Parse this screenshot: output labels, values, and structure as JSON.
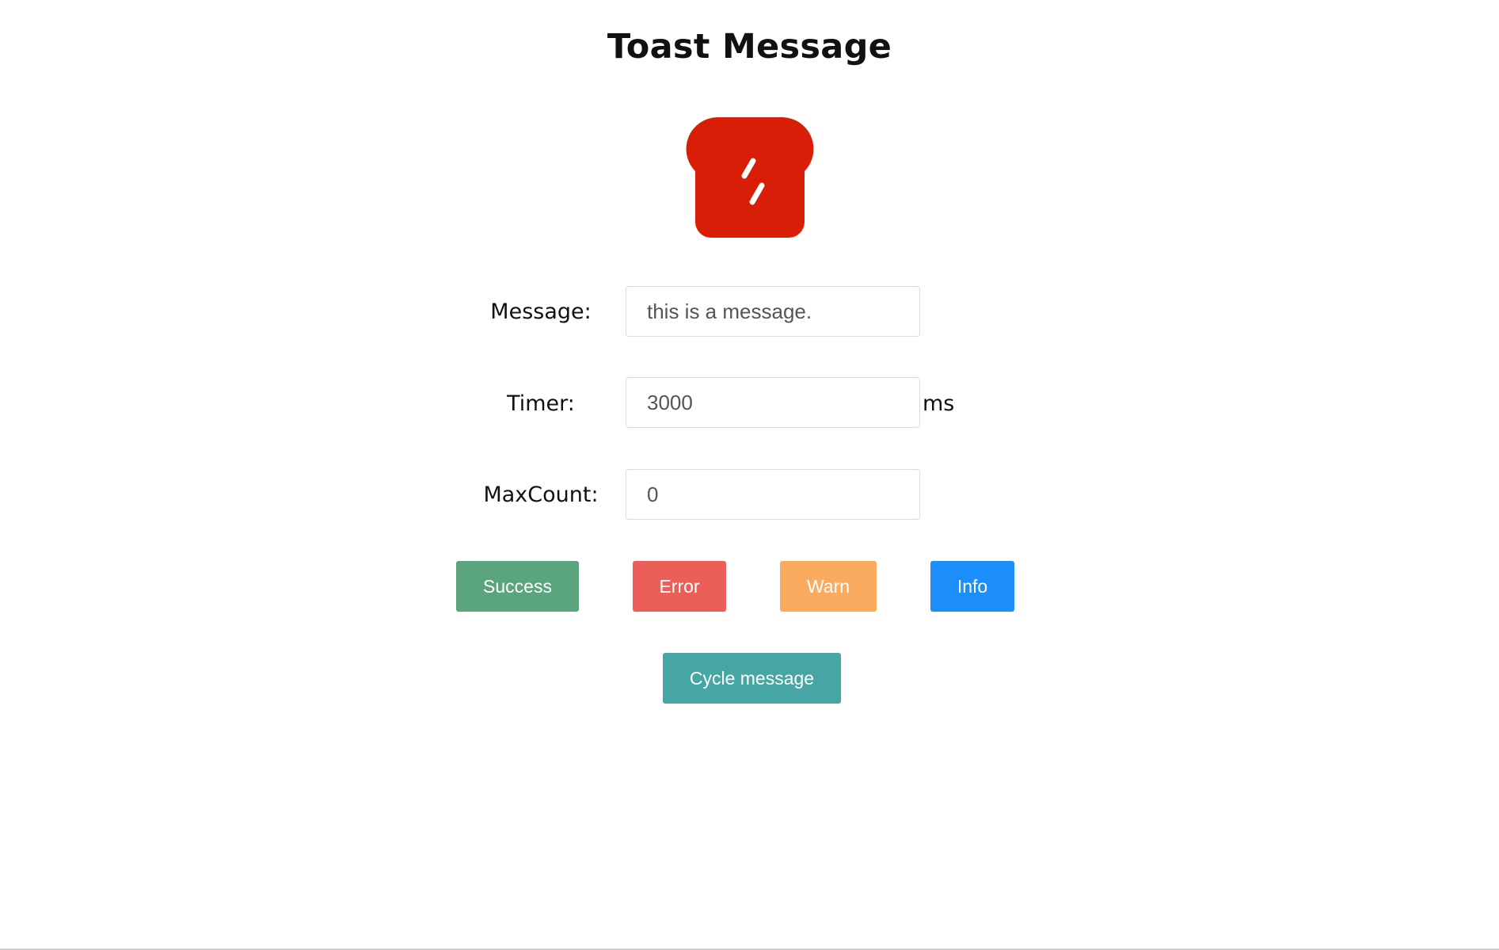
{
  "page": {
    "title": "Toast Message",
    "logo_icon": "toast-bread-icon",
    "logo_color": "#d81e06"
  },
  "form": {
    "message": {
      "label": "Message:",
      "placeholder": "this is a message.",
      "value": ""
    },
    "timer": {
      "label": "Timer:",
      "value": "3000",
      "suffix": "ms"
    },
    "max_count": {
      "label": "MaxCount:",
      "value": "0"
    }
  },
  "buttons": {
    "success": {
      "label": "Success",
      "color": "#5aa57d"
    },
    "error": {
      "label": "Error",
      "color": "#ec5f59"
    },
    "warn": {
      "label": "Warn",
      "color": "#fbab60"
    },
    "info": {
      "label": "Info",
      "color": "#1c8ef9"
    },
    "cycle": {
      "label": "Cycle message",
      "color": "#46a6a3"
    }
  }
}
